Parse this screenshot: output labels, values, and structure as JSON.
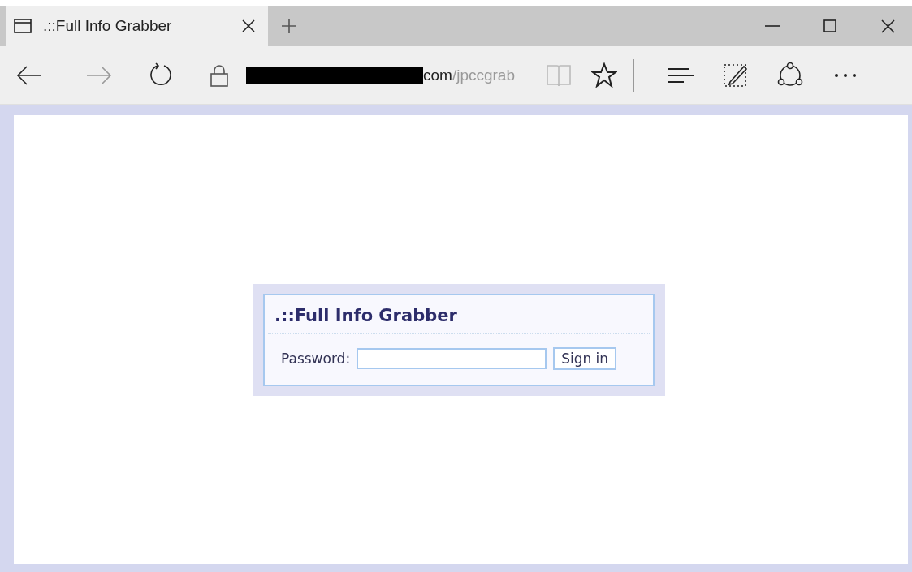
{
  "tabs": [
    {
      "title": ".::Full Info Grabber",
      "selected": true
    }
  ],
  "toolbar": {
    "back": {
      "disabled": false
    },
    "forward": {
      "disabled": true
    },
    "reading_view": {
      "disabled": true
    }
  },
  "address": {
    "redacted": true,
    "domain_end": "com",
    "path": "/jpccgrab"
  },
  "login": {
    "title": ".::Full Info Grabber",
    "label": "Password:",
    "button": "Sign in"
  }
}
